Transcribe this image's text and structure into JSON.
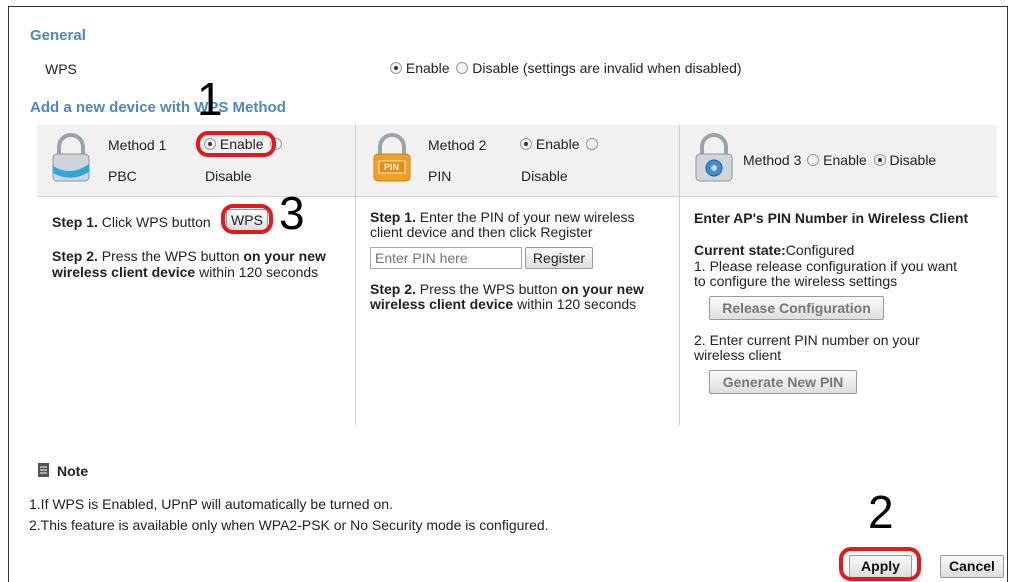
{
  "general": {
    "heading": "General",
    "wps_label": "WPS",
    "enable_label": "Enable",
    "disable_label": "Disable (settings are invalid when disabled)"
  },
  "wps_method": {
    "heading": "Add a new device with WPS Method",
    "method1": {
      "name": "Method 1",
      "type": "PBC",
      "enable": "Enable",
      "disable": "Disable",
      "step1_bold": "Step 1.",
      "step1_text": "Click WPS button",
      "wps_button": "WPS",
      "step2_bold": "Step 2.",
      "step2_pre": "Press the WPS button",
      "step2_bold2": "on your new wireless client device",
      "step2_post": "within 120 seconds"
    },
    "method2": {
      "name": "Method 2",
      "type": "PIN",
      "enable": "Enable",
      "disable": "Disable",
      "step1_bold": "Step 1.",
      "step1_text": "Enter the PIN of your new wireless client device and then click Register",
      "pin_placeholder": "Enter PIN here",
      "register_button": "Register",
      "step2_bold": "Step 2.",
      "step2_pre": "Press the WPS button",
      "step2_bold2": "on your new wireless client device",
      "step2_post": "within 120 seconds",
      "icon_text": "PIN"
    },
    "method3": {
      "name": "Method 3",
      "enable": "Enable",
      "disable": "Disable",
      "title": "Enter AP's PIN Number in Wireless Client",
      "state_label": "Current state:",
      "state_value": "Configured",
      "item1": "1. Please release configuration if you want to configure the wireless settings",
      "release_button": "Release Configuration",
      "item2": "2. Enter current PIN number  on your wireless client",
      "generate_button": "Generate New PIN"
    }
  },
  "note": {
    "title": "Note",
    "line1": "1.If WPS is Enabled, UPnP will automatically be turned on.",
    "line2": "2.This feature is available only when WPA2-PSK or No Security mode is configured."
  },
  "buttons": {
    "apply": "Apply",
    "cancel": "Cancel"
  },
  "annotations": {
    "n1": "1",
    "n2": "2",
    "n3": "3"
  },
  "colors": {
    "heading_blue": "#4d86c6",
    "annotation_red": "#e4181d"
  }
}
